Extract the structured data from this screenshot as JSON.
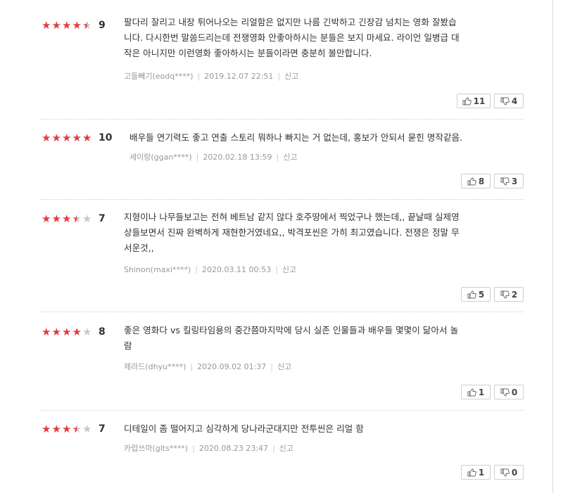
{
  "reviews": [
    {
      "score": "9",
      "rating": 4.5,
      "lines": [
        "팔다리 잘리고 내장 튀어나오는 리얼함은 없지만 나름 긴박하고 긴장감 넘치는 영화 잘봤습",
        "니다. 다시한번 말씀드리는데 전쟁영화 안좋아하시는 분들은 보지 마세요. 라이언 일병급 대",
        "작은 아니지만 이런영화 좋아하시는 분들이라면 충분히 볼만합니다."
      ],
      "author": "고들빼기(eodq****)",
      "date": "2019.12.07 22:51",
      "report": "신고",
      "likes": "11",
      "dislikes": "4"
    },
    {
      "score": "10",
      "rating": 5,
      "lines": [
        "배우들 연기력도 좋고 연출 스토리 뭐하나 빠지는 거 없는데, 홍보가 안되서 묻힌 명작같음."
      ],
      "author": "세이랑(ggan****)",
      "date": "2020.02.18 13:59",
      "report": "신고",
      "likes": "8",
      "dislikes": "3"
    },
    {
      "score": "7",
      "rating": 3.5,
      "lines": [
        "지형이나 나무들보고는 전혀 베트남 같지 않다 호주땅에서 찍었구나 했는데,, 끝날때 실제영",
        "상들보면서 진짜 완벽하게 재현한거였네요,, 박격포씬은 가히 최고였습니다. 전쟁은 정말 무",
        "서운것,,"
      ],
      "author": "Shinon(maxi****)",
      "date": "2020.03.11 00:53",
      "report": "신고",
      "likes": "5",
      "dislikes": "2"
    },
    {
      "score": "8",
      "rating": 4,
      "lines": [
        "좋은 영화다 vs 킬링타임용의 중간쯤마지막에 당시 실존 인물들과 배우들 몇몇이 닮아서 놀",
        "람"
      ],
      "author": "제라드(dhyu****)",
      "date": "2020.09.02 01:37",
      "report": "신고",
      "likes": "1",
      "dislikes": "0"
    },
    {
      "score": "7",
      "rating": 3.5,
      "lines": [
        "디테일이 좀 떨어지고 심각하게 당나라군대지만 전투씬은 리얼 함"
      ],
      "author": "카럽쓰마(glts****)",
      "date": "2020.08.23 23:47",
      "report": "신고",
      "likes": "1",
      "dislikes": "0"
    }
  ]
}
